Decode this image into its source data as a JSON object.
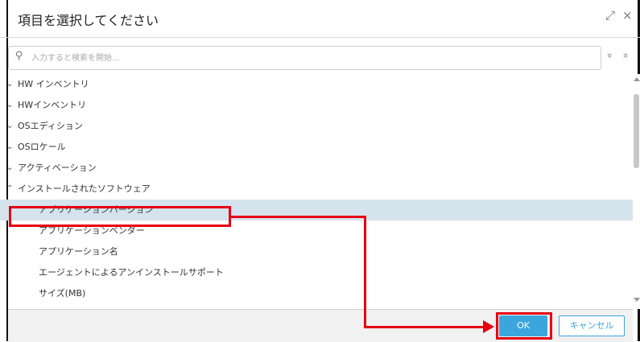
{
  "dialog": {
    "title": "項目を選択してください",
    "expand_icon": "⤢",
    "close_icon": "×"
  },
  "search": {
    "placeholder": "入力すると検索を開始...",
    "value": "",
    "expand_all_icon": "»",
    "collapse_all_icon": "«"
  },
  "tree": {
    "items": [
      {
        "label": "HW インベントリ",
        "expanded": false,
        "level": 0
      },
      {
        "label": "HWインベントリ",
        "expanded": false,
        "level": 0
      },
      {
        "label": "OSエディション",
        "expanded": false,
        "level": 0
      },
      {
        "label": "OSロケール",
        "expanded": false,
        "level": 0
      },
      {
        "label": "アクティベーション",
        "expanded": false,
        "level": 0
      },
      {
        "label": "インストールされたソフトウェア",
        "expanded": true,
        "level": 0
      },
      {
        "label": "アプリケーションバージョン",
        "level": 1,
        "selected": true
      },
      {
        "label": "アプリケーションベンダー",
        "level": 1
      },
      {
        "label": "アプリケーション名",
        "level": 1
      },
      {
        "label": "エージェントによるアンインストールサポート",
        "level": 1
      },
      {
        "label": "サイズ(MB)",
        "level": 1
      }
    ]
  },
  "footer": {
    "ok_label": "OK",
    "cancel_label": "キャンセル"
  },
  "colors": {
    "accent": "#3aa6dc",
    "selection": "#d5e3ed",
    "annotation": "#e60012"
  }
}
